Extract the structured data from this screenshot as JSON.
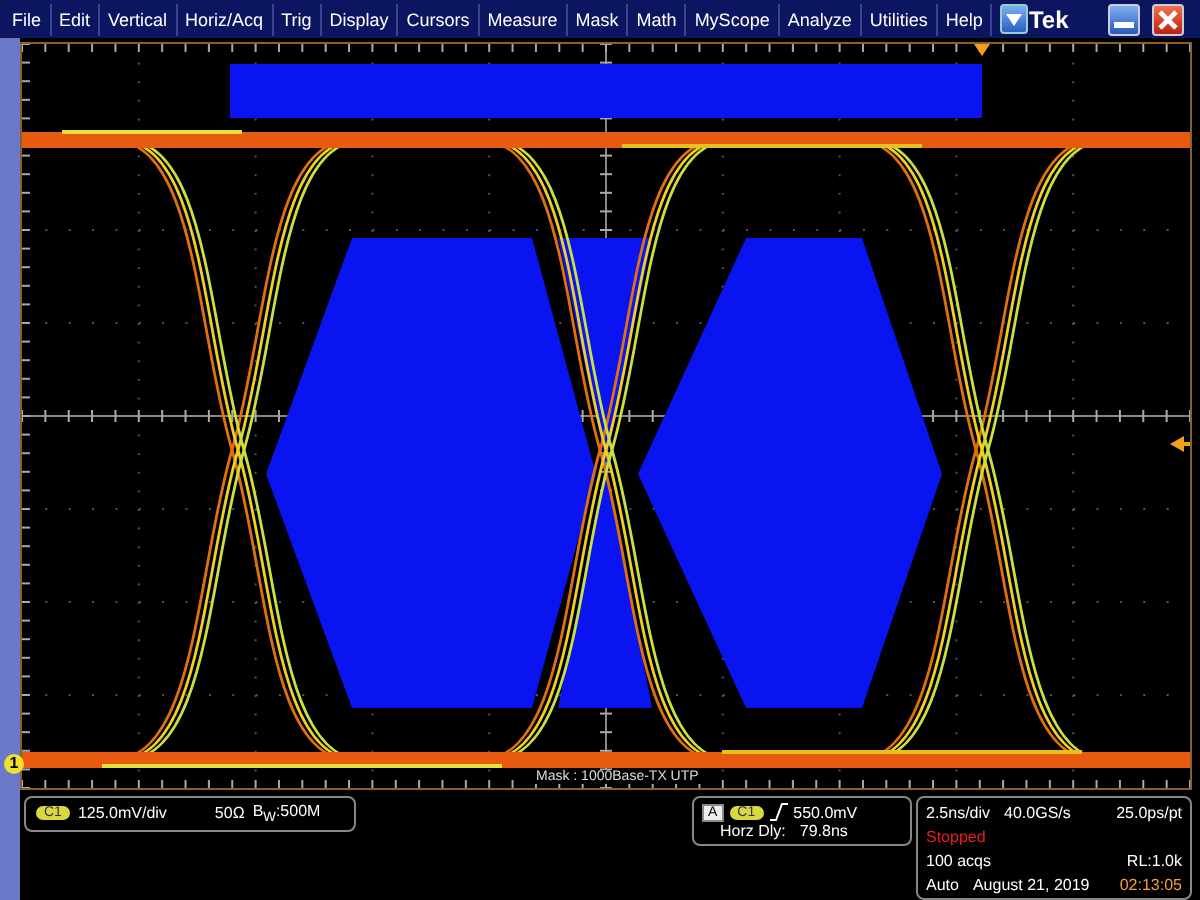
{
  "menu": [
    "File",
    "Edit",
    "Vertical",
    "Horiz/Acq",
    "Trig",
    "Display",
    "Cursors",
    "Measure",
    "Mask",
    "Math",
    "MyScope",
    "Analyze",
    "Utilities",
    "Help"
  ],
  "brand": "Tek",
  "graticule": {
    "channel_marker": "1",
    "mask_label": "Mask : 1000Base-TX UTP"
  },
  "vertical_readout": {
    "channel": "C1",
    "scale": "125.0mV/div",
    "termination": "50Ω",
    "bandwidth": "B$_{W}$:500M"
  },
  "trigger_readout": {
    "source": "A",
    "channel": "C1",
    "trigger_level": "550.0mV",
    "delay_label": "Horz Dly:",
    "delay": "79.8ns"
  },
  "acquisition": {
    "time_scale": "2.5ns/div",
    "sample_rate": "40.0GS/s",
    "resolution": "25.0ps/pt",
    "state": "Stopped",
    "acqs": "100 acqs",
    "record_length": "RL:1.0k",
    "mode": "Auto",
    "date": "August 21, 2019",
    "time": "02:13:05"
  }
}
